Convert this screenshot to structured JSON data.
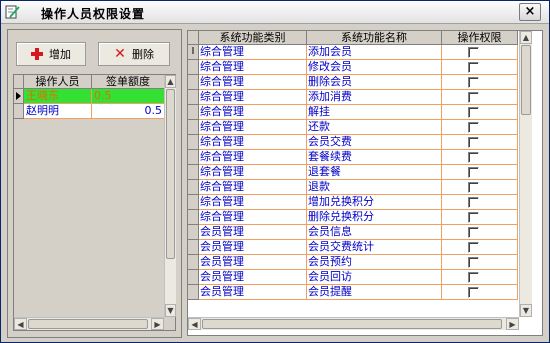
{
  "window": {
    "title": "操作人员权限设置",
    "close_label": "×"
  },
  "toolbar": {
    "add_label": "增加",
    "delete_label": "删除"
  },
  "operators": {
    "headers": [
      "操作人员",
      "签单额度"
    ],
    "rows": [
      {
        "name": "王晓东",
        "limit": "0.5",
        "selected": true
      },
      {
        "name": "赵明明",
        "limit": "0.5",
        "selected": false
      }
    ]
  },
  "permissions": {
    "headers": [
      "系统功能类别",
      "系统功能名称",
      "操作权限"
    ],
    "row_marker": "I",
    "rows": [
      {
        "category": "综合管理",
        "name": "添加会员",
        "checked": false
      },
      {
        "category": "综合管理",
        "name": "修改会员",
        "checked": false
      },
      {
        "category": "综合管理",
        "name": "删除会员",
        "checked": false
      },
      {
        "category": "综合管理",
        "name": "添加消费",
        "checked": false
      },
      {
        "category": "综合管理",
        "name": "解挂",
        "checked": false
      },
      {
        "category": "综合管理",
        "name": "还款",
        "checked": false
      },
      {
        "category": "综合管理",
        "name": "会员交费",
        "checked": false
      },
      {
        "category": "综合管理",
        "name": "套餐续费",
        "checked": false
      },
      {
        "category": "综合管理",
        "name": "退套餐",
        "checked": false
      },
      {
        "category": "综合管理",
        "name": "退款",
        "checked": false
      },
      {
        "category": "综合管理",
        "name": "增加兑换积分",
        "checked": false
      },
      {
        "category": "综合管理",
        "name": "删除兑换积分",
        "checked": false
      },
      {
        "category": "会员管理",
        "name": "会员信息",
        "checked": false
      },
      {
        "category": "会员管理",
        "name": "会员交费统计",
        "checked": false
      },
      {
        "category": "会员管理",
        "name": "会员预约",
        "checked": false
      },
      {
        "category": "会员管理",
        "name": "会员回访",
        "checked": false
      },
      {
        "category": "会员管理",
        "name": "会员提醒",
        "checked": false
      }
    ]
  },
  "colors": {
    "selected_row_bg": "#33e033",
    "selected_row_text": "#e07000",
    "grid_line": "#f0a060",
    "cell_text": "#0000c8"
  }
}
